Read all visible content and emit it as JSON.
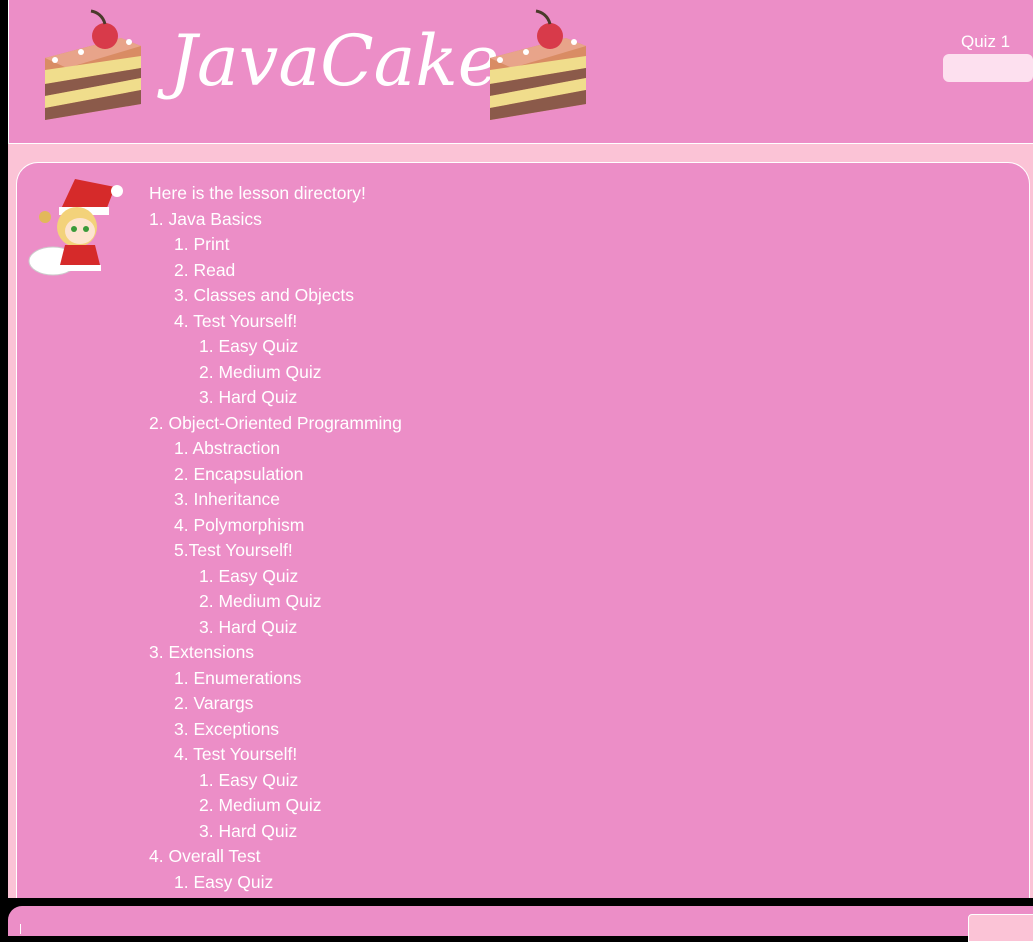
{
  "app": {
    "title": "JavaCake"
  },
  "header": {
    "quiz_label": "Quiz 1",
    "quiz_input_value": ""
  },
  "directory": {
    "intro": "Here is the lesson directory!",
    "items": [
      {
        "level": 1,
        "text": "1. Java Basics"
      },
      {
        "level": 2,
        "text": "1. Print"
      },
      {
        "level": 2,
        "text": "2. Read"
      },
      {
        "level": 2,
        "text": "3. Classes and Objects"
      },
      {
        "level": 2,
        "text": "4. Test Yourself!"
      },
      {
        "level": 3,
        "text": "1. Easy Quiz"
      },
      {
        "level": 3,
        "text": "2. Medium Quiz"
      },
      {
        "level": 3,
        "text": "3. Hard Quiz"
      },
      {
        "level": 1,
        "text": "2. Object-Oriented Programming"
      },
      {
        "level": 2,
        "text": "1. Abstraction"
      },
      {
        "level": 2,
        "text": "2. Encapsulation"
      },
      {
        "level": 2,
        "text": "3. Inheritance"
      },
      {
        "level": 2,
        "text": "4. Polymorphism"
      },
      {
        "level": 2,
        "text": "5.Test Yourself!"
      },
      {
        "level": 3,
        "text": "1. Easy Quiz"
      },
      {
        "level": 3,
        "text": "2. Medium Quiz"
      },
      {
        "level": 3,
        "text": "3. Hard Quiz"
      },
      {
        "level": 1,
        "text": "3. Extensions"
      },
      {
        "level": 2,
        "text": "1. Enumerations"
      },
      {
        "level": 2,
        "text": "2. Varargs"
      },
      {
        "level": 2,
        "text": "3. Exceptions"
      },
      {
        "level": 2,
        "text": "4. Test Yourself!"
      },
      {
        "level": 3,
        "text": "1. Easy Quiz"
      },
      {
        "level": 3,
        "text": "2. Medium Quiz"
      },
      {
        "level": 3,
        "text": "3. Hard Quiz"
      },
      {
        "level": 1,
        "text": "4. Overall Test"
      },
      {
        "level": 2,
        "text": "1. Easy Quiz"
      }
    ]
  },
  "colors": {
    "header_bg": "#ec8ec7",
    "panel_bg": "#ec8ec7",
    "frame_bg": "#fbc3d6",
    "text": "#ffffff"
  },
  "icons": {
    "cake": "cake-slice-icon",
    "avatar": "santa-girl-avatar"
  }
}
